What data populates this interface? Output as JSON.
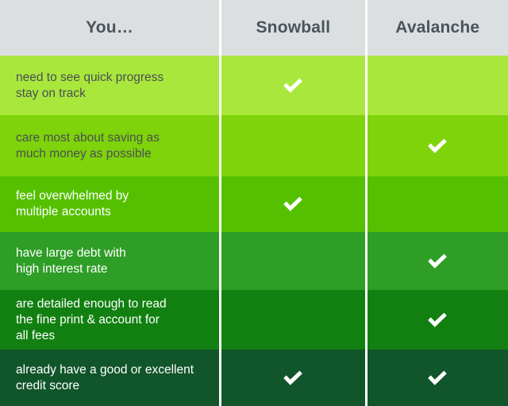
{
  "table": {
    "columns": [
      {
        "key": "criteria",
        "label": "You…"
      },
      {
        "key": "snowball",
        "label": "Snowball"
      },
      {
        "key": "avalanche",
        "label": "Avalanche"
      }
    ],
    "header_background": "#dcdfe0",
    "header_text_color": "#4b545c",
    "divider_color": "#ffffff",
    "check_icon": "check-mark",
    "check_color": "#ffffff",
    "rows": [
      {
        "criteria": "need to see quick progress\nstay on track",
        "snowball": true,
        "avalanche": false,
        "background": "#a9e73c",
        "text_color": "#4a4f55"
      },
      {
        "criteria": "care most about saving as\nmuch money as possible",
        "snowball": false,
        "avalanche": true,
        "background": "#7ed30a",
        "text_color": "#4a4f55"
      },
      {
        "criteria": "feel overwhelmed by\nmultiple accounts",
        "snowball": true,
        "avalanche": false,
        "background": "#54c000",
        "text_color": "#ffffff"
      },
      {
        "criteria": "have large debt with\nhigh interest rate",
        "snowball": false,
        "avalanche": true,
        "background": "#2e9e26",
        "text_color": "#ffffff"
      },
      {
        "criteria": "are detailed enough to read\nthe fine print & account for\nall fees",
        "snowball": false,
        "avalanche": true,
        "background": "#118011",
        "text_color": "#ffffff"
      },
      {
        "criteria": "already have a good or excellent\ncredit score",
        "snowball": true,
        "avalanche": true,
        "background": "#11552a",
        "text_color": "#ffffff"
      }
    ]
  }
}
